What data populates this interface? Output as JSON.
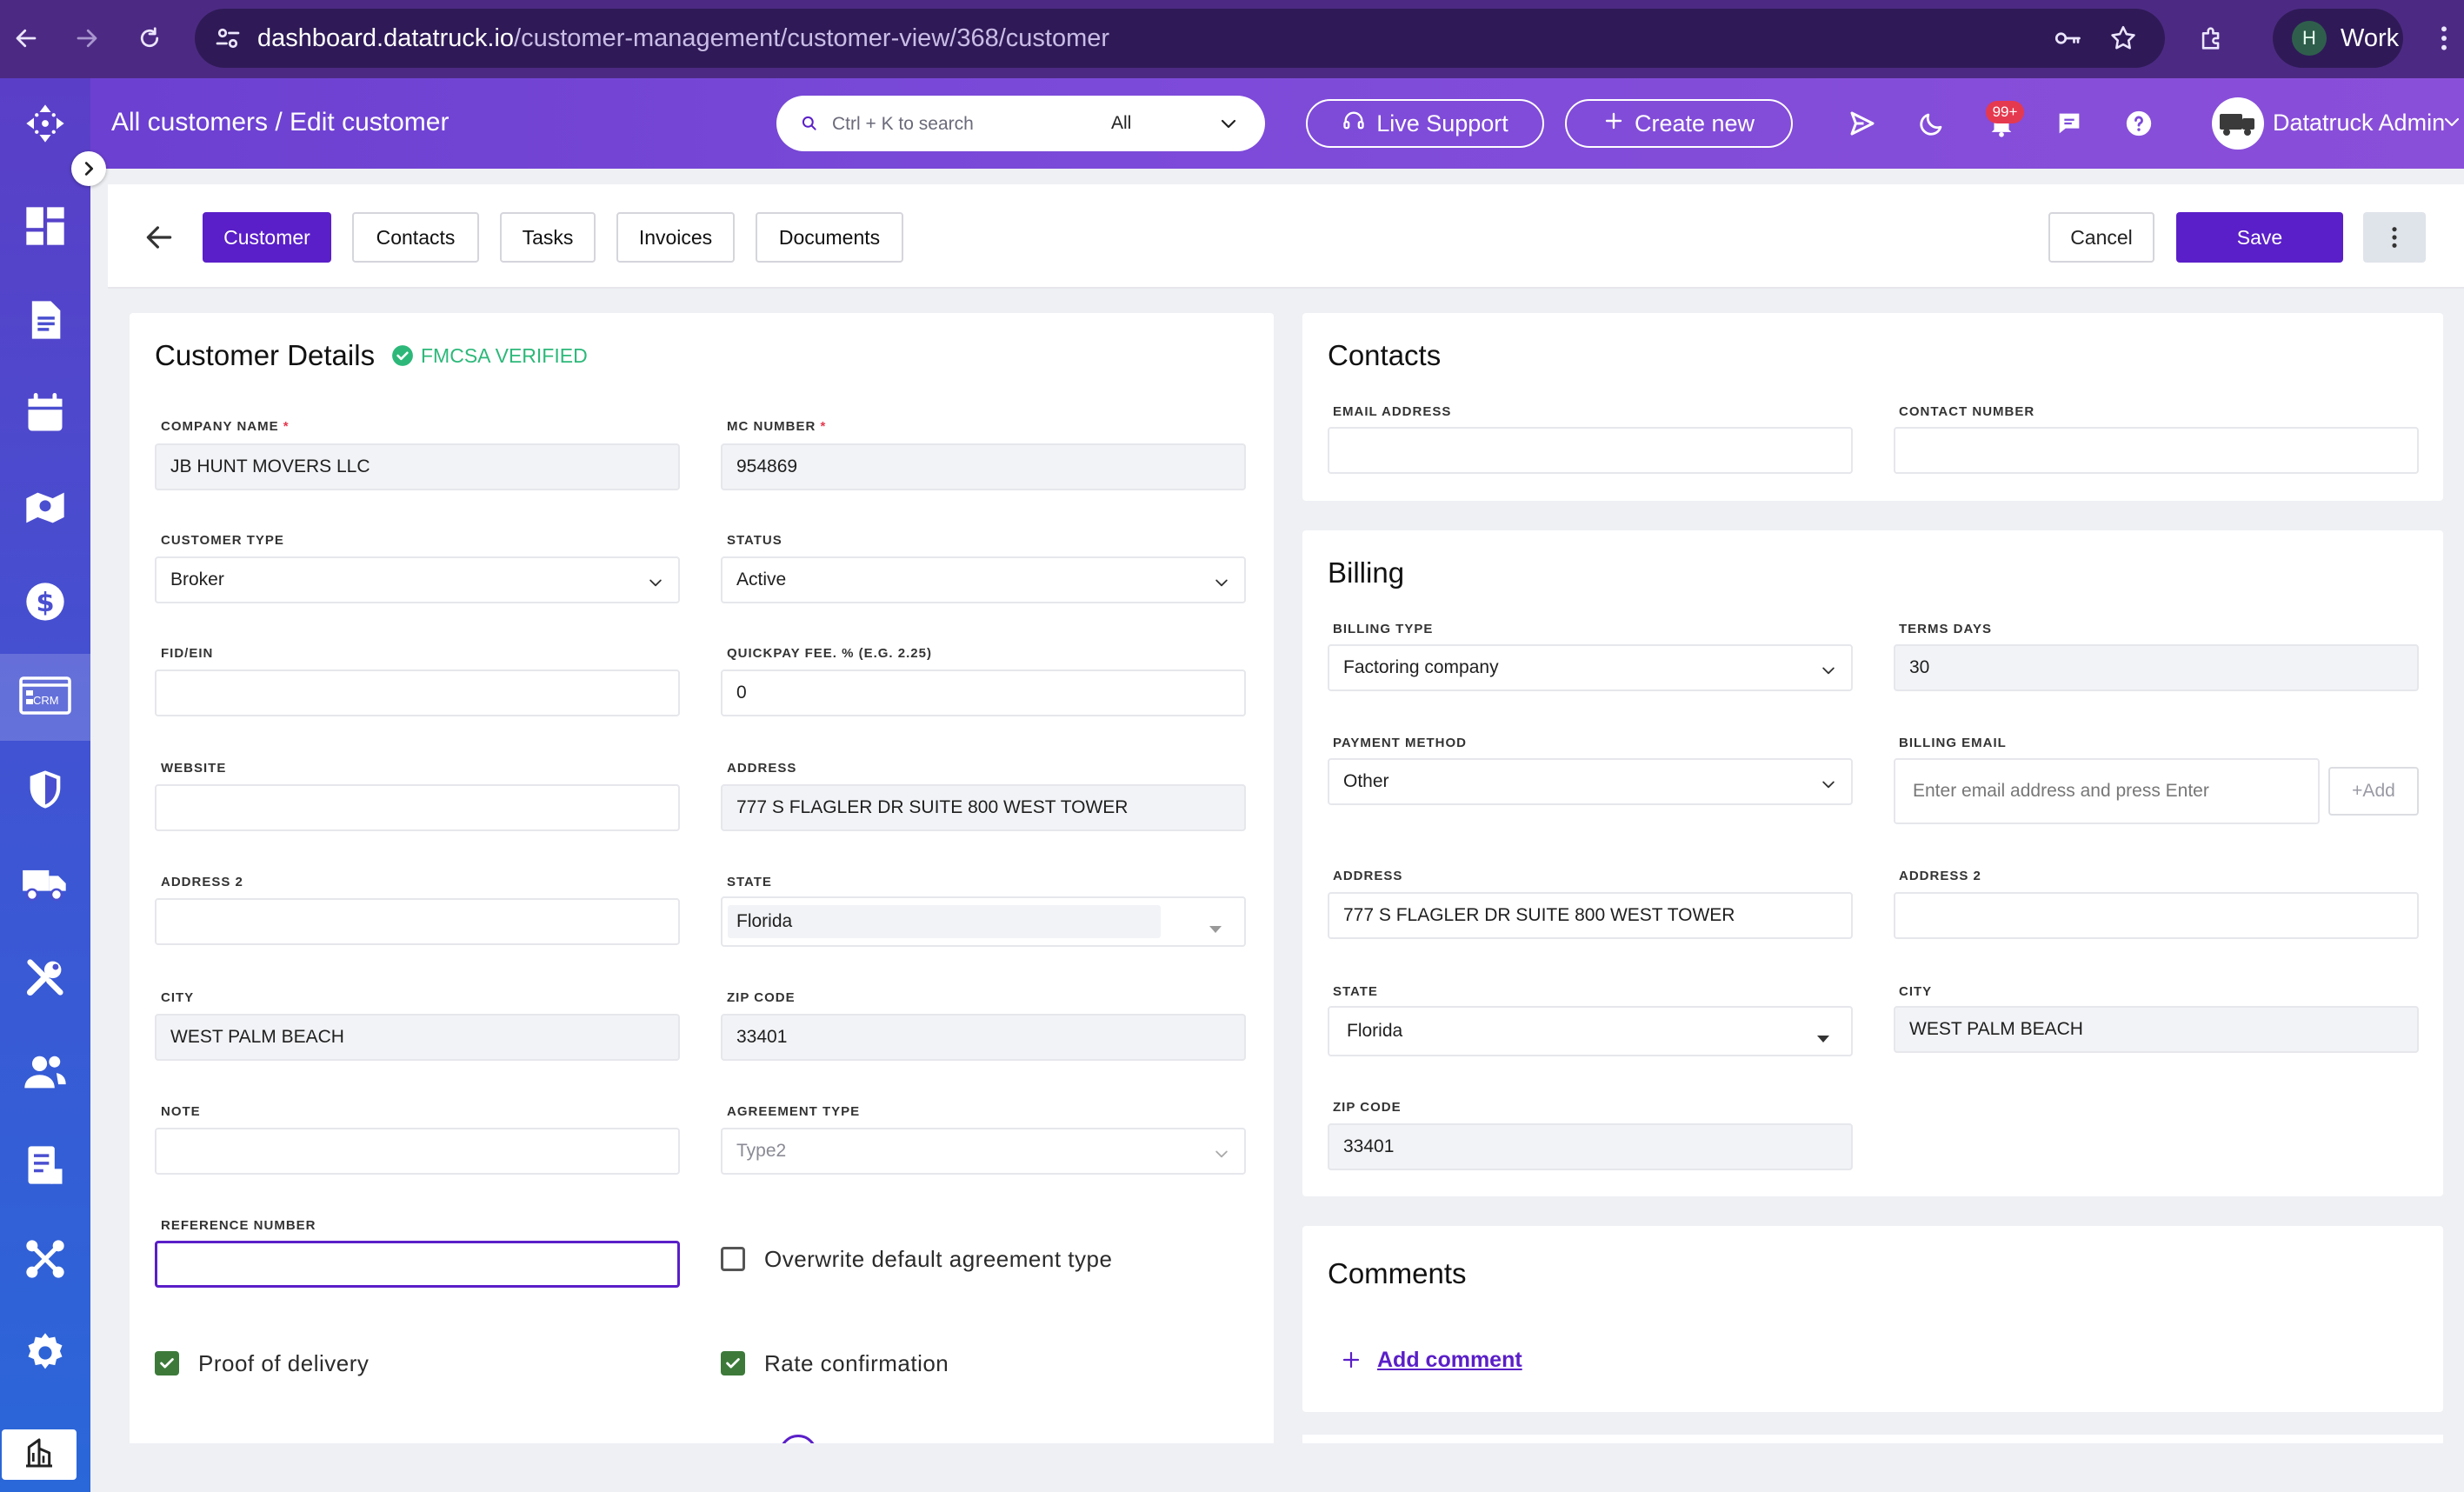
{
  "browser": {
    "url_host": "dashboard.datatruck.io",
    "url_path": "/customer-management/customer-view/368/customer",
    "profile_initial": "H",
    "profile_label": "Work"
  },
  "header": {
    "breadcrumb": "All customers / Edit customer",
    "search_placeholder": "Ctrl + K to search",
    "search_scope": "All",
    "live_support": "Live Support",
    "create_new": "Create new",
    "notification_badge": "99+",
    "user_name": "Datatruck Admin"
  },
  "sidebar": {
    "items": [
      "dashboard",
      "documents",
      "calendar",
      "map",
      "billing",
      "crm",
      "safety",
      "trucks",
      "maintenance",
      "users",
      "reports",
      "integrations",
      "settings",
      "company"
    ],
    "crm_label": "CRM"
  },
  "toolbar": {
    "tabs": [
      "Customer",
      "Contacts",
      "Tasks",
      "Invoices",
      "Documents"
    ],
    "active_tab": "Customer",
    "cancel": "Cancel",
    "save": "Save"
  },
  "customer_details": {
    "title": "Customer Details",
    "verified_badge": "FMCSA VERIFIED",
    "company_name_label": "COMPANY NAME",
    "company_name": "JB HUNT MOVERS LLC",
    "mc_number_label": "MC NUMBER",
    "mc_number": "954869",
    "customer_type_label": "CUSTOMER TYPE",
    "customer_type": "Broker",
    "status_label": "STATUS",
    "status": "Active",
    "fid_label": "FID/EIN",
    "fid": "",
    "quickpay_label": "QUICKPAY FEE. % (E.G. 2.25)",
    "quickpay": "0",
    "website_label": "WEBSITE",
    "website": "",
    "address_label": "ADDRESS",
    "address": "777 S FLAGLER DR SUITE 800 WEST TOWER",
    "address2_label": "ADDRESS 2",
    "address2": "",
    "state_label": "STATE",
    "state": "Florida",
    "city_label": "CITY",
    "city": "WEST PALM BEACH",
    "zip_label": "ZIP CODE",
    "zip": "33401",
    "note_label": "NOTE",
    "note": "",
    "agreement_label": "AGREEMENT TYPE",
    "agreement": "Type2",
    "reference_label": "REFERENCE NUMBER",
    "reference": "",
    "overwrite_label": "Overwrite default agreement type",
    "overwrite_checked": false,
    "proof_label": "Proof of delivery",
    "proof_checked": true,
    "rate_label": "Rate confirmation",
    "rate_checked": true
  },
  "contacts": {
    "title": "Contacts",
    "email_label": "EMAIL ADDRESS",
    "email": "",
    "phone_label": "CONTACT NUMBER",
    "phone": ""
  },
  "billing": {
    "title": "Billing",
    "type_label": "BILLING TYPE",
    "type": "Factoring company",
    "terms_label": "TERMS DAYS",
    "terms": "30",
    "payment_label": "PAYMENT METHOD",
    "payment": "Other",
    "email_label": "BILLING EMAIL",
    "email_placeholder": "Enter email address and press Enter",
    "add_label": "+Add",
    "address_label": "ADDRESS",
    "address": "777 S FLAGLER DR SUITE 800 WEST TOWER",
    "address2_label": "ADDRESS 2",
    "address2": "",
    "state_label": "STATE",
    "state": "Florida",
    "city_label": "CITY",
    "city": "WEST PALM BEACH",
    "zip_label": "ZIP CODE",
    "zip": "33401"
  },
  "comments": {
    "title": "Comments",
    "add_comment": "Add comment"
  },
  "colors": {
    "primary": "#5a1fc8",
    "verified": "#2db87a",
    "checkbox": "#3d7a3a",
    "badge": "#e53950"
  }
}
